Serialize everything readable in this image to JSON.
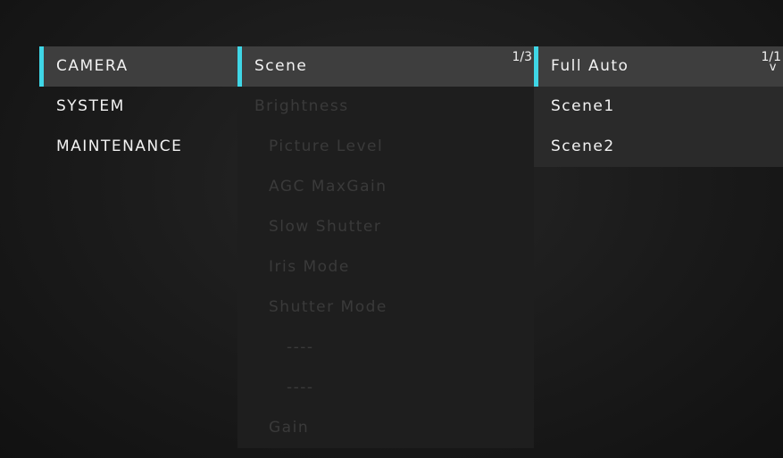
{
  "main_menu": {
    "items": [
      {
        "label": "CAMERA"
      },
      {
        "label": "SYSTEM"
      },
      {
        "label": "MAINTENANCE"
      }
    ]
  },
  "sub_menu": {
    "page_indicator": "1/3",
    "items": [
      {
        "label": "Scene"
      },
      {
        "label": "Brightness"
      },
      {
        "label": "Picture Level"
      },
      {
        "label": "AGC MaxGain"
      },
      {
        "label": "Slow Shutter"
      },
      {
        "label": "Iris Mode"
      },
      {
        "label": "Shutter Mode"
      },
      {
        "label": "----"
      },
      {
        "label": "----"
      },
      {
        "label": "Gain"
      }
    ]
  },
  "options_menu": {
    "page_indicator": "1/1",
    "more_indicator": "v",
    "items": [
      {
        "label": "Full Auto"
      },
      {
        "label": "Scene1"
      },
      {
        "label": "Scene2"
      }
    ]
  },
  "colors": {
    "cursor": "#3fd6e6",
    "selected_row": "#3e3e3e",
    "text": "#f2f2f2",
    "disabled_text": "#3a3a3a"
  }
}
